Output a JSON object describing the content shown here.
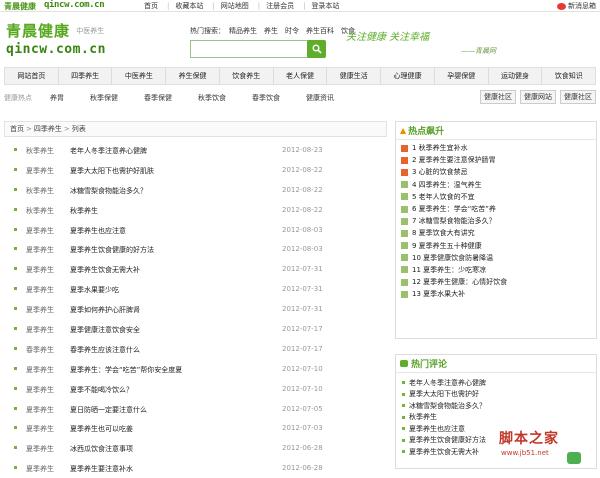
{
  "topbar": {
    "logo": "青晨健康",
    "domain": "qincw.com.cn",
    "links": [
      "首页",
      "收藏本站",
      "网站地图",
      "注册会员",
      "登录本站"
    ],
    "mail": "新消息箱"
  },
  "brand": {
    "name": "青晨健康",
    "tag": "中医养生",
    "domain": "qincw.com.cn"
  },
  "hot": {
    "label": "热门搜索：",
    "words": [
      "精品养生",
      "养生",
      "时令",
      "养生百科",
      "饮食"
    ]
  },
  "search": {
    "placeholder": ""
  },
  "slogan": {
    "line1": "关注健康 关注幸福",
    "line2": "——青晨网"
  },
  "nav": [
    "网站首页",
    "四季养生",
    "中医养生",
    "养生保健",
    "饮食养生",
    "老人保健",
    "健康生活",
    "心理健康",
    "孕婴保健",
    "运动健身",
    "饮食知识"
  ],
  "hotrow": {
    "label": "健康热点",
    "items": [
      "养胃",
      "秋季保健",
      "春季保健",
      "秋季饮食",
      "春季饮食",
      "健康资讯"
    ],
    "tags": [
      "健康社区",
      "健康网站",
      "健康社区"
    ]
  },
  "breadcrumb": {
    "home": "首页",
    "sep": ">",
    "section": "四季养生",
    "leaf": "列表"
  },
  "list": [
    {
      "cat": "秋季养生",
      "title": "老年人冬季注意养心健脾",
      "date": "2012-08-23"
    },
    {
      "cat": "夏季养生",
      "title": "夏季大太阳下也需护好肌肤",
      "date": "2012-08-22"
    },
    {
      "cat": "秋季养生",
      "title": "冰糖雪梨食物能治多久？",
      "date": "2012-08-22"
    },
    {
      "cat": "秋季养生",
      "title": "秋季养生",
      "date": "2012-08-22"
    },
    {
      "cat": "夏季养生",
      "title": "夏季养生也应注意",
      "date": "2012-08-03"
    },
    {
      "cat": "夏季养生",
      "title": "夏季养生饮食健康的好方法",
      "date": "2012-08-03"
    },
    {
      "cat": "夏季养生",
      "title": "夏季养生饮食无需大补",
      "date": "2012-07-31"
    },
    {
      "cat": "夏季养生",
      "title": "夏季水果要少吃",
      "date": "2012-07-31"
    },
    {
      "cat": "夏季养生",
      "title": "夏季如何养护心肝脾肾",
      "date": "2012-07-31"
    },
    {
      "cat": "夏季养生",
      "title": "夏季健康注意饮食安全",
      "date": "2012-07-17"
    },
    {
      "cat": "春季养生",
      "title": "春季养生应该注意什么",
      "date": "2012-07-17"
    },
    {
      "cat": "夏季养生",
      "title": "夏季养生：学会“吃苦”帮你安全度夏",
      "date": "2012-07-10"
    },
    {
      "cat": "夏季养生",
      "title": "夏季不能喝冷饮么？",
      "date": "2012-07-10"
    },
    {
      "cat": "夏季养生",
      "title": "夏日防晒一定要注意什么",
      "date": "2012-07-05"
    },
    {
      "cat": "夏季养生",
      "title": "夏季养生也可以吃姜",
      "date": "2012-07-03"
    },
    {
      "cat": "夏季养生",
      "title": "冰西瓜饮食注意事项",
      "date": "2012-06-28"
    },
    {
      "cat": "夏季养生",
      "title": "夏季养生要注意补水",
      "date": "2012-06-28"
    }
  ],
  "side1": {
    "title": "热点飙升",
    "items": [
      "1 秋季养生宜补水",
      "2 夏季养生要注意保护肠胃",
      "3 心脏的饮食禁忌",
      "4 四季养生：湿气养生",
      "5 老年人饮食的不宜",
      "6 夏季养生：学会“吃苦”养",
      "7 冰糖雪梨食物能治多久？",
      "8 夏季饮食大有讲究",
      "9 夏季养生五十种健康",
      "10 夏季健康饮食防暑降温",
      "11 夏季养生：少吃寒凉",
      "12 夏季养生健康：心情好饮食",
      "13 夏季水果大补"
    ]
  },
  "side2": {
    "title": "热门评论",
    "items": [
      "老年人冬季注意养心健脾",
      "夏季大太阳下也需护好",
      "冰糖雪梨食物能治多久？",
      "秋季养生",
      "夏季养生也应注意",
      "夏季养生饮食健康好方法",
      "夏季养生饮食无需大补"
    ]
  },
  "watermark": {
    "big": "脚本之家",
    "small": "www.jb51.net"
  }
}
